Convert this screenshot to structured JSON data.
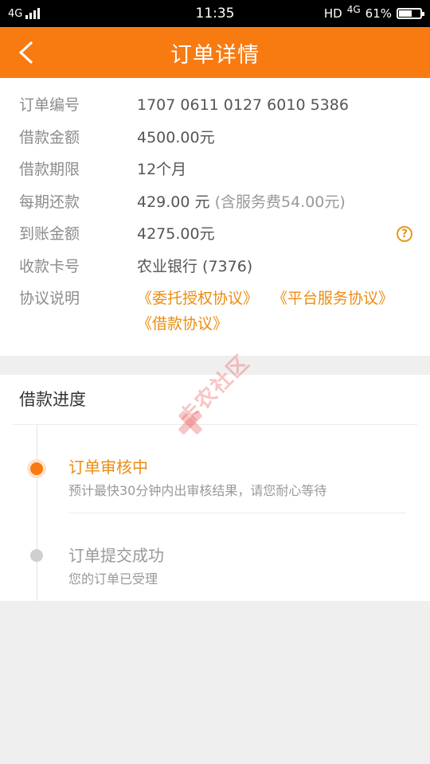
{
  "status_bar": {
    "network": "4G",
    "time": "11:35",
    "hd": "HD",
    "network_right": "4G",
    "battery": "61%",
    "battery_level": 0.61
  },
  "header": {
    "title": "订单详情",
    "back_icon": "chevron-left-icon"
  },
  "details": {
    "rows": [
      {
        "label": "订单编号",
        "value": "1707 0611 0127 6010 5386"
      },
      {
        "label": "借款金额",
        "value": "4500.00元"
      },
      {
        "label": "借款期限",
        "value": "12个月"
      },
      {
        "label": "每期还款",
        "value": "429.00 元",
        "note": "(含服务费54.00元)"
      },
      {
        "label": "到账金额",
        "value": "4275.00元",
        "icon": "question-circle-icon"
      },
      {
        "label": "收款卡号",
        "value": "农业银行 (7376)"
      }
    ],
    "agreements_label": "协议说明",
    "agreements": [
      "《委托授权协议》",
      "《平台服务协议》",
      "《借款协议》"
    ]
  },
  "progress": {
    "title": "借款进度",
    "steps": [
      {
        "title": "订单审核中",
        "desc": "预计最快30分钟内出审核结果，请您耐心等待",
        "state": "active"
      },
      {
        "title": "订单提交成功",
        "desc": "您的订单已受理",
        "state": "done"
      }
    ]
  },
  "watermark": {
    "text": "卡农社区"
  },
  "colors": {
    "brand": "#f87b12",
    "link": "#ec8c12",
    "background": "#efefef"
  }
}
